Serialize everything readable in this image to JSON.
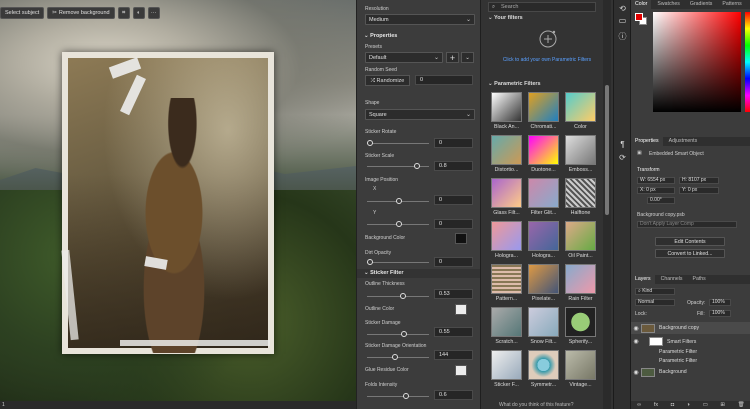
{
  "canvas": {
    "toolbar": {
      "select_subject": "Select subject",
      "remove_background": "Remove background",
      "more": "···"
    },
    "status": "1"
  },
  "properties_panel": {
    "resolution_label": "Resolution",
    "resolution_value": "Medium",
    "properties_header": "Properties",
    "presets_label": "Presets",
    "presets_value": "Default",
    "random_seed_label": "Random Seed",
    "randomize_label": "Randomize",
    "random_seed_value": "0",
    "shape_label": "Shape",
    "shape_value": "Square",
    "sticker_rotate_label": "Sticker Rotate",
    "sticker_rotate_value": "0",
    "sticker_scale_label": "Sticker Scale",
    "sticker_scale_value": "0.8",
    "image_position_label": "Image Position",
    "x_label": "X",
    "x_value": "0",
    "y_label": "Y",
    "y_value": "0",
    "background_color_label": "Background Color",
    "dirt_opacity_label": "Dirt Opacity",
    "dirt_opacity_value": "0",
    "sticker_filter_header": "Sticker Filter",
    "outline_thickness_label": "Outline Thickness",
    "outline_thickness_value": "0.53",
    "outline_color_label": "Outline Color",
    "sticker_damage_label": "Sticker Damage",
    "sticker_damage_value": "0.55",
    "damage_orientation_label": "Sticker Damage Orientation",
    "damage_orientation_value": "144",
    "glue_residue_label": "Glue Residue Color",
    "folds_intensity_label": "Folds Intensity",
    "folds_intensity_value": "0.6"
  },
  "filters_panel": {
    "search_placeholder": "Search",
    "your_filters_header": "Your filters",
    "your_filters_text": "Click to add your own Parametric Filters",
    "parametric_header": "Parametric Filters",
    "tiles": [
      "Black An...",
      "Chromati...",
      "Color",
      "Distortio...",
      "Duotone...",
      "Emboss...",
      "Glass Filt...",
      "Filter Glit...",
      "Halftone",
      "Hologra...",
      "Hologra...",
      "Oil Paint...",
      "Pattern...",
      "Pixelate...",
      "Rain Filter",
      "Scratch...",
      "Snow Filt...",
      "Spherify...",
      "Sticker F...",
      "Symmetr...",
      "Vintage..."
    ],
    "feedback": "What do you think of this feature?"
  },
  "right_panels": {
    "color_tabs": [
      "Color",
      "Swatches",
      "Gradients",
      "Patterns"
    ],
    "properties_tabs": [
      "Properties",
      "Adjustments"
    ],
    "smart_object_label": "Embedded Smart Object",
    "transform_label": "Transform",
    "w_value": "W: 6554 px",
    "h_value": "H: 8107 px",
    "x_value": "X: 0 px",
    "y_value": "Y: 0 px",
    "angle_value": "0.00°",
    "layer_source": "Background copy.psb",
    "layer_comp": "Don't Apply Layer Comp",
    "edit_contents": "Edit Contents",
    "convert_linked": "Convert to Linked...",
    "layers_tabs": [
      "Layers",
      "Channels",
      "Paths"
    ],
    "kind_label": "Kind",
    "blend_mode": "Normal",
    "opacity_label": "Opacity:",
    "opacity_value": "100%",
    "lock_label": "Lock:",
    "fill_label": "Fill:",
    "fill_value": "100%",
    "layers": [
      {
        "name": "Background copy"
      },
      {
        "name": "Smart Filters"
      },
      {
        "name": "Parametric Filter"
      },
      {
        "name": "Parametric Filter"
      },
      {
        "name": "Background"
      }
    ]
  },
  "colors": {
    "accent": "#5aa0ff",
    "foreground": "#e00000",
    "background": "#ffffff"
  }
}
